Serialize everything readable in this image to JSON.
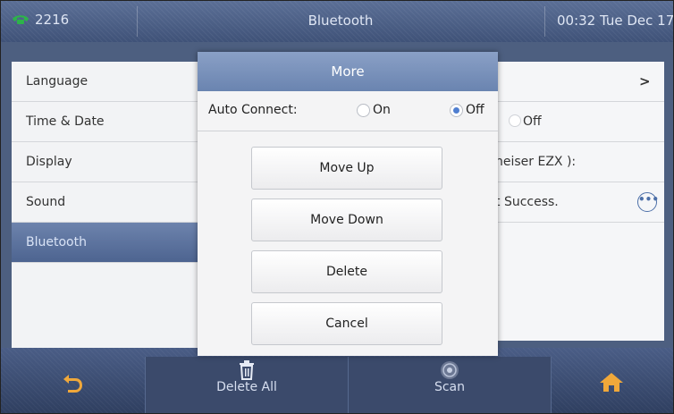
{
  "status_bar": {
    "account": "2216",
    "title": "Bluetooth",
    "datetime": "00:32 Tue Dec 17"
  },
  "menu": {
    "items": [
      {
        "label": "Language"
      },
      {
        "label": "Time & Date"
      },
      {
        "label": "Display"
      },
      {
        "label": "Sound"
      },
      {
        "label": "Bluetooth"
      }
    ]
  },
  "content": {
    "row1_arrow": ">",
    "row2_off": "Off",
    "row3_text": "heiser EZX ):",
    "row4_text": "t Success.",
    "more_icon": "more-icon"
  },
  "dialog": {
    "title": "More",
    "auto_connect_label": "Auto Connect:",
    "on_label": "On",
    "off_label": "Off",
    "selected": "Off",
    "buttons": [
      "Move Up",
      "Move Down",
      "Delete",
      "Cancel"
    ]
  },
  "bottom_bar": {
    "back_icon": "back-icon",
    "delete_all": "Delete All",
    "scan": "Scan",
    "home_icon": "home-icon"
  }
}
